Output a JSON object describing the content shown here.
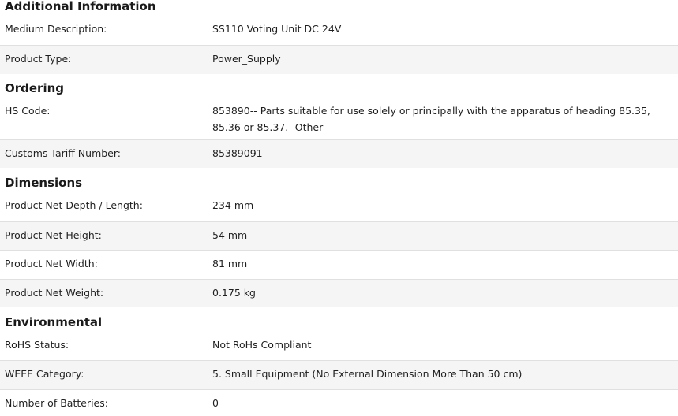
{
  "sections": [
    {
      "title": "Additional Information",
      "rows": [
        {
          "label": "Medium Description:",
          "value": "SS110 Voting Unit DC 24V"
        },
        {
          "label": "Product Type:",
          "value": "Power_Supply"
        }
      ]
    },
    {
      "title": "Ordering",
      "rows": [
        {
          "label": "HS Code:",
          "value": "853890-- Parts suitable for use solely or principally with the apparatus of heading 85.35, 85.36 or 85.37.- Other"
        },
        {
          "label": "Customs Tariff Number:",
          "value": "85389091"
        }
      ]
    },
    {
      "title": "Dimensions",
      "rows": [
        {
          "label": "Product Net Depth / Length:",
          "value": "234 mm"
        },
        {
          "label": "Product Net Height:",
          "value": "54 mm"
        },
        {
          "label": "Product Net Width:",
          "value": "81 mm"
        },
        {
          "label": "Product Net Weight:",
          "value": "0.175 kg"
        }
      ]
    },
    {
      "title": "Environmental",
      "rows": [
        {
          "label": "RoHS Status:",
          "value": "Not RoHs Compliant"
        },
        {
          "label": "WEEE Category:",
          "value": "5. Small Equipment (No External Dimension More Than 50 cm)"
        },
        {
          "label": "Number of Batteries:",
          "value": "0"
        }
      ]
    }
  ]
}
